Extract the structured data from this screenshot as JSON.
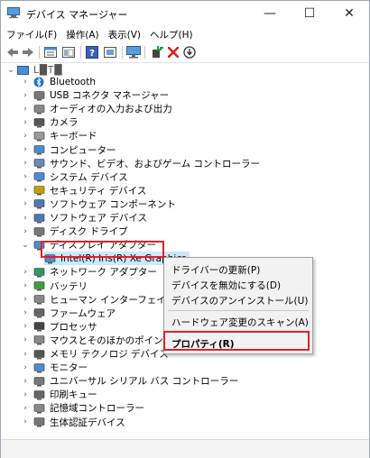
{
  "window": {
    "title": "デバイス マネージャー",
    "minimize_glyph": "—",
    "maximize_glyph": "☐",
    "close_glyph": "✕"
  },
  "menu": [
    "ファイル(F)",
    "操作(A)",
    "表示(V)",
    "ヘルプ(H)"
  ],
  "toolbar_icons": [
    "back-arrow-icon",
    "forward-arrow-icon",
    "properties-icon",
    "show-hide-icon",
    "help-icon",
    "view-icon",
    "monitor-scan-icon",
    "add-driver-icon",
    "uninstall-x-icon",
    "update-driver-icon"
  ],
  "tree": {
    "root_label": "L█T█",
    "items": [
      {
        "label": "Bluetooth",
        "icon": "bluetooth-icon"
      },
      {
        "label": "USB コネクタ マネージャー",
        "icon": "usb-icon"
      },
      {
        "label": "オーディオの入力および出力",
        "icon": "speaker-icon"
      },
      {
        "label": "カメラ",
        "icon": "camera-icon"
      },
      {
        "label": "キーボード",
        "icon": "keyboard-icon"
      },
      {
        "label": "コンピューター",
        "icon": "computer-icon"
      },
      {
        "label": "サウンド、ビデオ、およびゲーム コントローラー",
        "icon": "sound-icon"
      },
      {
        "label": "システム デバイス",
        "icon": "system-icon"
      },
      {
        "label": "セキュリティ デバイス",
        "icon": "security-icon"
      },
      {
        "label": "ソフトウェア コンポーネント",
        "icon": "software-component-icon"
      },
      {
        "label": "ソフトウェア デバイス",
        "icon": "software-device-icon"
      },
      {
        "label": "ディスク ドライブ",
        "icon": "disk-icon"
      },
      {
        "label": "ディスプレイ アダプター",
        "icon": "display-adapter-icon",
        "expanded": true
      },
      {
        "label": "Intel(R) Iris(R) Xe Graphics",
        "icon": "display-icon",
        "child": true
      },
      {
        "label": "ネットワーク アダプター",
        "icon": "network-icon"
      },
      {
        "label": "バッテリ",
        "icon": "battery-icon"
      },
      {
        "label": "ヒューマン インターフェイス デバ",
        "icon": "hid-icon"
      },
      {
        "label": "ファームウェア",
        "icon": "firmware-icon"
      },
      {
        "label": "プロセッサ",
        "icon": "processor-icon"
      },
      {
        "label": "マウスとそのほかのポインティ",
        "icon": "mouse-icon"
      },
      {
        "label": "メモリ テクノロジ デバイス",
        "icon": "memory-icon"
      },
      {
        "label": "モニター",
        "icon": "monitor-icon"
      },
      {
        "label": "ユニバーサル シリアル バス コントローラー",
        "icon": "usb-controller-icon"
      },
      {
        "label": "印刷キュー",
        "icon": "printer-icon"
      },
      {
        "label": "記憶域コントローラー",
        "icon": "storage-icon"
      },
      {
        "label": "生体認証デバイス",
        "icon": "biometric-icon"
      }
    ]
  },
  "context_menu": {
    "update_driver": "ドライバーの更新(P)",
    "disable_device": "デバイスを無効にする(D)",
    "uninstall_device": "デバイスのアンインストール(U)",
    "scan_hardware": "ハードウェア変更のスキャン(A)",
    "properties": "プロパティ(R)"
  },
  "colors": {
    "highlight": "#e0202a",
    "selection": "#cce8ff",
    "accent": "#4a8bd4"
  }
}
